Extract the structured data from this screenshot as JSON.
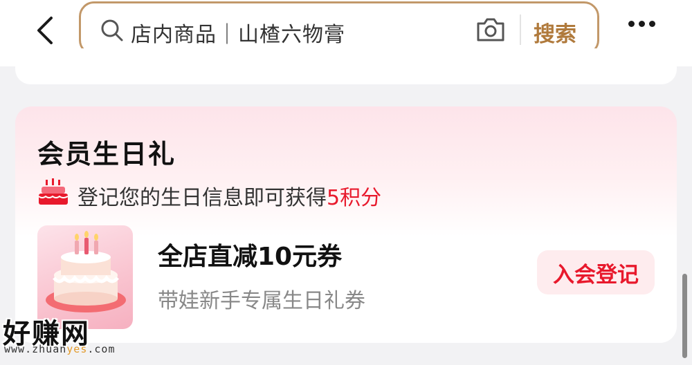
{
  "search": {
    "text": "店内商品｜山楂六物膏",
    "button_label": "搜索"
  },
  "card": {
    "title": "会员生日礼",
    "info_prefix": "登记您的生日信息即可获得",
    "info_points": "5积分",
    "coupon": {
      "title": "全店直减10元券",
      "subtitle": "带娃新手专属生日礼券",
      "button_label": "入会登记"
    }
  },
  "watermark": {
    "title": "好赚网",
    "url_prefix": "www.zhuan",
    "url_highlight": "yes",
    "url_suffix": ".com"
  },
  "colors": {
    "accent_brown": "#b07a3c",
    "search_border": "#c29869",
    "points_red": "#e8192c",
    "button_bg": "#feecee"
  },
  "icons": [
    "back-arrow-icon",
    "search-icon",
    "camera-icon",
    "more-icon",
    "cake-icon"
  ]
}
